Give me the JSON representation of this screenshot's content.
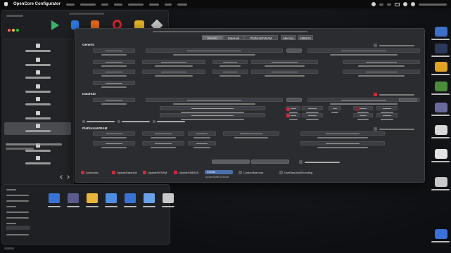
{
  "menubar": {
    "app_name": "OpenCore Configurator"
  },
  "dialog": {
    "tabs": [
      {
        "label": "Generic"
      },
      {
        "label": "DataHub"
      },
      {
        "label": "PlatformNVRAM"
      },
      {
        "label": "Memory"
      },
      {
        "label": "SMBIOS"
      }
    ],
    "sections": [
      {
        "title": "Generic"
      },
      {
        "title": "DataHub"
      },
      {
        "title": "PlatformNVRAM"
      }
    ],
    "bottom_options": [
      {
        "label": "Automatic",
        "checked": true
      },
      {
        "label": "UpdateDataHub",
        "checked": true
      },
      {
        "label": "UpdateNVRAM",
        "checked": true
      },
      {
        "label": "UpdateSMBIOS",
        "checked": true
      }
    ],
    "smbios_mode": {
      "value": "Create",
      "label": "UpdateSMBIOSMode"
    },
    "extra_options": [
      {
        "label": "CustomMemory",
        "checked": false
      },
      {
        "label": "UseRawUuidEncoding",
        "checked": false
      }
    ]
  },
  "colors": {
    "accent_red": "#d2283c",
    "dialog_bg": "#2b2c2f",
    "selection": "#4a4c52",
    "dropdown": "#4c6fa8"
  },
  "icons": {
    "toolbar": [
      "play-store-icon",
      "arrow-icon",
      "orange-app-icon",
      "opera-icon",
      "package-icon",
      "cube-icon"
    ],
    "desktop": [
      "folder-icon",
      "app-icon",
      "dots-icon",
      "app-icon",
      "image-icon",
      "drive-icon",
      "document-icon",
      "drive-icon",
      "app-icon"
    ]
  }
}
